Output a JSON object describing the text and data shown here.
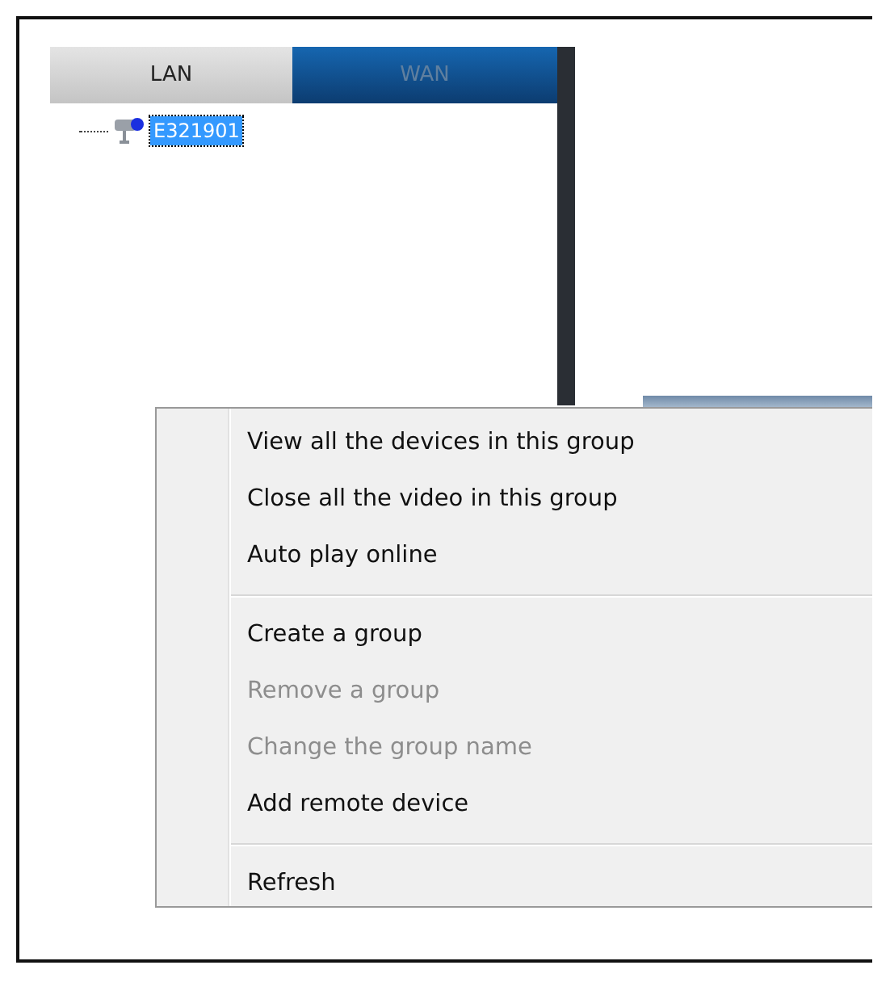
{
  "tabs": [
    {
      "label": "LAN",
      "selected": true
    },
    {
      "label": "WAN",
      "selected": false
    }
  ],
  "tree": [
    {
      "label": "E321901",
      "selected": true
    }
  ],
  "context_menu": [
    {
      "kind": "item",
      "label": "View all the devices in this group",
      "disabled": false
    },
    {
      "kind": "item",
      "label": "Close all the video in this group",
      "disabled": false
    },
    {
      "kind": "item",
      "label": "Auto play online",
      "disabled": false
    },
    {
      "kind": "separator"
    },
    {
      "kind": "item",
      "label": "Create a group",
      "disabled": false
    },
    {
      "kind": "item",
      "label": "Remove a group",
      "disabled": true
    },
    {
      "kind": "item",
      "label": "Change the group name",
      "disabled": true
    },
    {
      "kind": "item",
      "label": "Add remote device",
      "disabled": false
    },
    {
      "kind": "separator"
    },
    {
      "kind": "item",
      "label": "Refresh",
      "disabled": false
    }
  ]
}
